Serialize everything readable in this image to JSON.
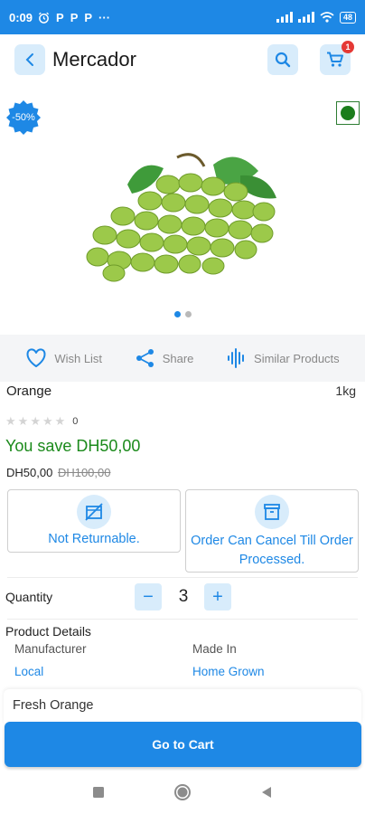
{
  "status_bar": {
    "time": "0:09",
    "notif_icons": [
      "alarm-icon",
      "p-icon",
      "p-icon",
      "p-icon",
      "more-icon"
    ],
    "battery": "48"
  },
  "app_bar": {
    "title": "Mercador",
    "cart_count": "1"
  },
  "product": {
    "discount_badge": "-50%",
    "name": "Orange",
    "unit": "1kg",
    "rating_count": "0",
    "savings_text": "You save DH50,00",
    "price": "DH50,00",
    "original_price": "DH100,00",
    "carousel_dots": 2,
    "carousel_active": 0
  },
  "actions": {
    "wishlist": "Wish List",
    "share": "Share",
    "similar": "Similar Products"
  },
  "policies": {
    "returnable": "Not Returnable.",
    "cancel": "Order Can Cancel Till Order Processed."
  },
  "quantity": {
    "label": "Quantity",
    "value": "3",
    "minus": "−",
    "plus": "+"
  },
  "details": {
    "title": "Product Details",
    "manufacturer_label": "Manufacturer",
    "manufacturer_value": "Local",
    "made_in_label": "Made In",
    "made_in_value": "Home Grown",
    "description": "Fresh Orange"
  },
  "cta": {
    "go_to_cart": "Go to Cart"
  },
  "colors": {
    "primary": "#1e88e5",
    "save_green": "#1b8a1b",
    "badge_red": "#e53935"
  }
}
